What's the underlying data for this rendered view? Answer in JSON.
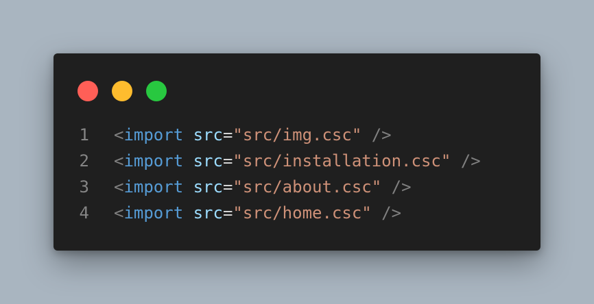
{
  "window": {
    "controls": [
      {
        "name": "close",
        "color": "#ff5f57"
      },
      {
        "name": "minimize",
        "color": "#febc2e"
      },
      {
        "name": "maximize",
        "color": "#28c840"
      }
    ]
  },
  "code": {
    "lines": [
      {
        "number": "1",
        "open": "<",
        "tag": "import",
        "attr": "src",
        "eq": "=",
        "value": "\"src/img.csc\"",
        "close": "/>"
      },
      {
        "number": "2",
        "open": "<",
        "tag": "import",
        "attr": "src",
        "eq": "=",
        "value": "\"src/installation.csc\"",
        "close": "/>"
      },
      {
        "number": "3",
        "open": "<",
        "tag": "import",
        "attr": "src",
        "eq": "=",
        "value": "\"src/about.csc\"",
        "close": "/>"
      },
      {
        "number": "4",
        "open": "<",
        "tag": "import",
        "attr": "src",
        "eq": "=",
        "value": "\"src/home.csc\"",
        "close": "/>"
      }
    ]
  }
}
